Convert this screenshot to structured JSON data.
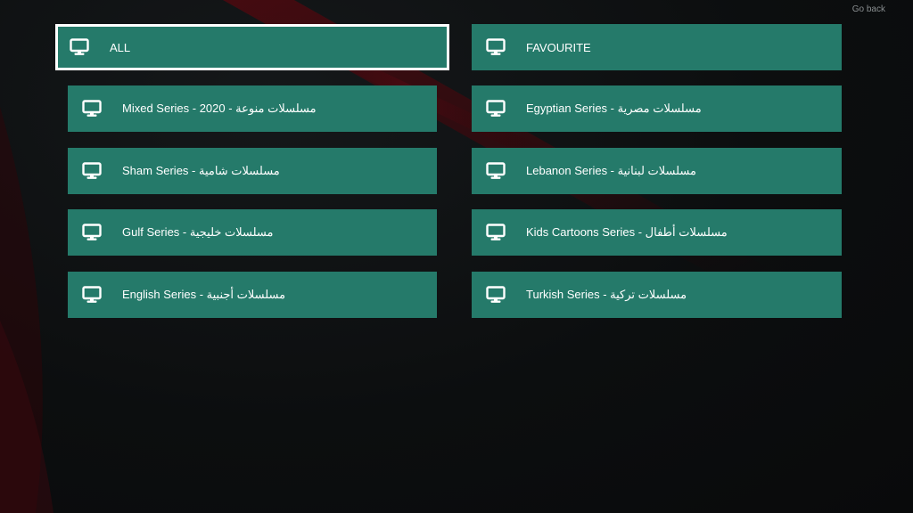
{
  "header": {
    "go_back_label": "Go back"
  },
  "tiles": [
    {
      "label": "ALL",
      "selected": true
    },
    {
      "label": "FAVOURITE",
      "selected": false
    },
    {
      "label": "Mixed Series - 2020 - مسلسلات منوعة",
      "selected": false
    },
    {
      "label": "Egyptian Series - مسلسلات مصرية",
      "selected": false
    },
    {
      "label": "Sham Series - مسلسلات شامية",
      "selected": false
    },
    {
      "label": "Lebanon Series - مسلسلات لبنانية",
      "selected": false
    },
    {
      "label": "Gulf Series - مسلسلات خليجية",
      "selected": false
    },
    {
      "label": "Kids Cartoons Series - مسلسلات أطفال",
      "selected": false
    },
    {
      "label": "English Series - مسلسلات أجنبية",
      "selected": false
    },
    {
      "label": "Turkish Series - مسلسلات تركية",
      "selected": false
    }
  ],
  "icons": {
    "tile_icon": "monitor-icon"
  },
  "colors": {
    "tile_background": "#257a6a",
    "tile_text": "#ffffff",
    "selected_border": "#ffffff",
    "background": "#0b0d0e",
    "accent_red": "#5a0d14"
  }
}
